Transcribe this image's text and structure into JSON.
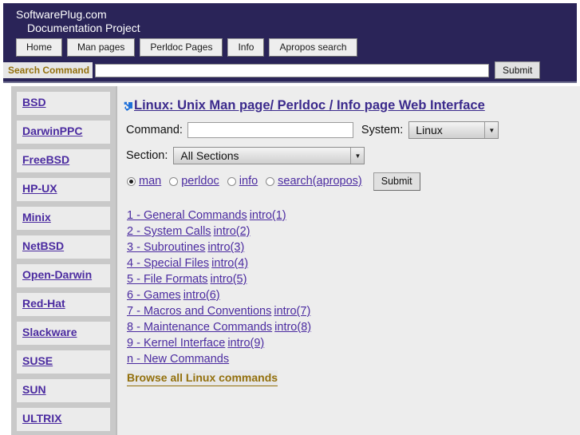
{
  "header": {
    "site_title_line1": "SoftwarePlug.com",
    "site_title_line2": "Documentation Project",
    "nav": [
      {
        "label": "Home"
      },
      {
        "label": "Man pages"
      },
      {
        "label": "Perldoc Pages"
      },
      {
        "label": "Info"
      },
      {
        "label": "Apropos search"
      }
    ],
    "search": {
      "label": "Search Command",
      "value": "",
      "placeholder": "",
      "submit_label": "Submit"
    },
    "colors": {
      "navy": "#2a2458",
      "gold": "#93700d"
    }
  },
  "sidebar": {
    "items": [
      {
        "label": "BSD"
      },
      {
        "label": "DarwinPPC"
      },
      {
        "label": "FreeBSD"
      },
      {
        "label": "HP-UX"
      },
      {
        "label": "Minix"
      },
      {
        "label": "NetBSD"
      },
      {
        "label": "Open-Darwin"
      },
      {
        "label": "Red-Hat"
      },
      {
        "label": "Slackware"
      },
      {
        "label": "SUSE"
      },
      {
        "label": "SUN"
      },
      {
        "label": "ULTRIX"
      }
    ]
  },
  "main": {
    "heading": "Linux: Unix Man page/ Perldoc / Info page Web Interface",
    "heading_icon": "arrow-down-left-icon",
    "form": {
      "command_label": "Command:",
      "command_value": "",
      "command_placeholder": "",
      "system_label": "System:",
      "system_value": "Linux",
      "section_label": "Section:",
      "section_value": "All Sections",
      "submit_label": "Submit",
      "doc_types": [
        {
          "label": "man",
          "checked": true
        },
        {
          "label": "perldoc",
          "checked": false
        },
        {
          "label": "info",
          "checked": false
        },
        {
          "label": "search(apropos)",
          "checked": false
        }
      ]
    },
    "sections": [
      {
        "label": "1 - General Commands",
        "intro": "intro(1)"
      },
      {
        "label": "2 - System Calls",
        "intro": "intro(2)"
      },
      {
        "label": "3 - Subroutines",
        "intro": "intro(3)"
      },
      {
        "label": "4 - Special Files",
        "intro": "intro(4)"
      },
      {
        "label": "5 - File Formats",
        "intro": "intro(5)"
      },
      {
        "label": "6 - Games",
        "intro": "intro(6)"
      },
      {
        "label": "7 - Macros and Conventions",
        "intro": "intro(7)"
      },
      {
        "label": "8 - Maintenance Commands",
        "intro": "intro(8)"
      },
      {
        "label": "9 - Kernel Interface",
        "intro": "intro(9)"
      },
      {
        "label": "n - New Commands",
        "intro": ""
      }
    ],
    "browse_all_label": "Browse all Linux commands"
  }
}
